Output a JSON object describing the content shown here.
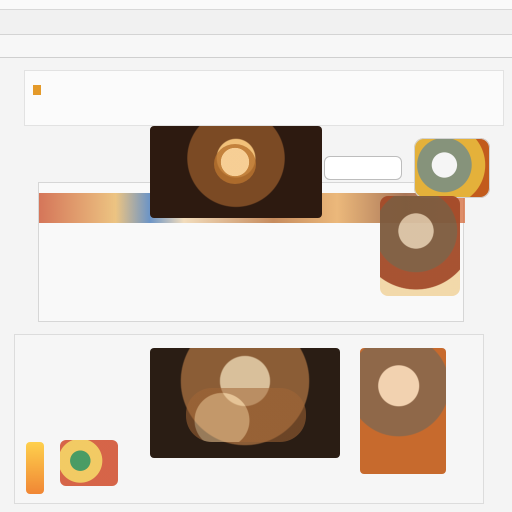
{
  "browser": {
    "top_label": "",
    "bar_label": ""
  },
  "header": {
    "logo_text": "",
    "nav_text": "",
    "right_text": ""
  },
  "feature": {
    "pill_label": "",
    "headline": "",
    "subheadline": "",
    "meta": ""
  },
  "left_sidebar": {
    "line1": "",
    "line2": ""
  },
  "bottom": {
    "title": "",
    "subtitle": "",
    "copy": "",
    "meta": "",
    "right_control": ""
  },
  "colors": {
    "accent": "#8a2b16",
    "logo_orange": "#e49a2a"
  }
}
